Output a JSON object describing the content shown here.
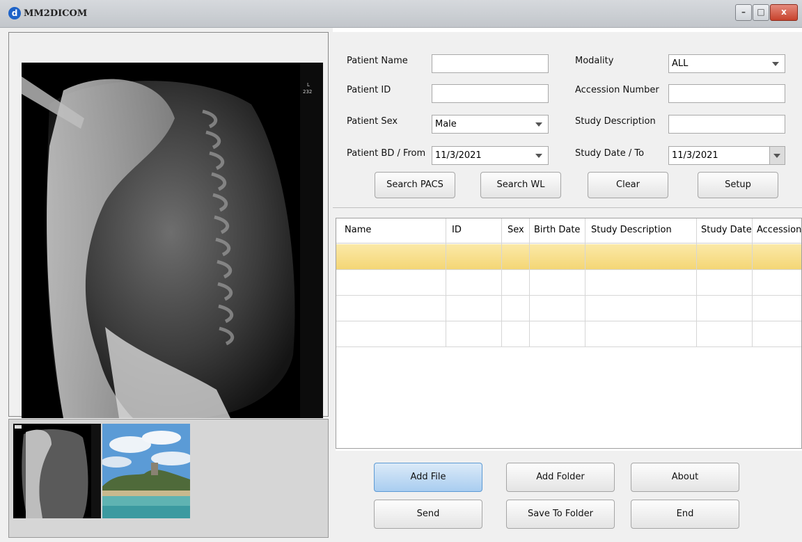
{
  "window": {
    "title": "MM2DICOM",
    "logo_glyph": "d",
    "minimize": "–",
    "maximize": "□",
    "close": "x"
  },
  "form": {
    "patient_name_label": "Patient Name",
    "patient_name_value": "",
    "patient_id_label": "Patient ID",
    "patient_id_value": "",
    "patient_sex_label": "Patient Sex",
    "patient_sex_value": "Male",
    "patient_bd_label": "Patient BD / From",
    "patient_bd_value": "11/3/2021",
    "modality_label": "Modality",
    "modality_value": "ALL",
    "accession_label": "Accession Number",
    "accession_value": "",
    "study_desc_label": "Study Description",
    "study_desc_value": "",
    "study_date_label": "Study Date / To",
    "study_date_value": "11/3/2021"
  },
  "search_buttons": {
    "search_pacs": "Search PACS",
    "search_wl": "Search WL",
    "clear": "Clear",
    "setup": "Setup"
  },
  "table": {
    "columns": [
      "Name",
      "ID",
      "Sex",
      "Birth Date",
      "Study Description",
      "Study Date",
      "Accession"
    ],
    "rows": 4,
    "selected_row": 0
  },
  "actions": {
    "add_file": "Add File",
    "add_folder": "Add Folder",
    "about": "About",
    "send": "Send",
    "save_to_folder": "Save To Folder",
    "end": "End"
  },
  "xray_overlay": {
    "corner_text_1": "L",
    "corner_text_2": "232"
  },
  "colors": {
    "accent_button": "#a9cdf0",
    "selected_row": "#f4d675",
    "close_button": "#c7422c"
  }
}
